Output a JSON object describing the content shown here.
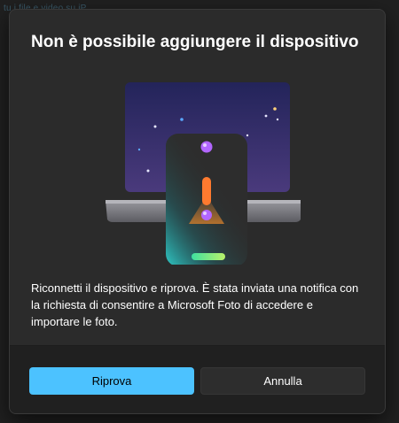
{
  "background": {
    "text": "tu i file e video su iP..."
  },
  "dialog": {
    "title": "Non è possibile aggiungere il dispositivo",
    "message": "Riconnetti il dispositivo e riprova. È stata inviata una notifica con la richiesta di consentire a Microsoft Foto di accedere e importare le foto.",
    "primary_button": "Riprova",
    "secondary_button": "Annulla"
  },
  "colors": {
    "accent": "#4cc2ff",
    "dialog_bg": "#2b2b2b",
    "footer_bg": "#202020",
    "warning": "#ff7a2f"
  }
}
